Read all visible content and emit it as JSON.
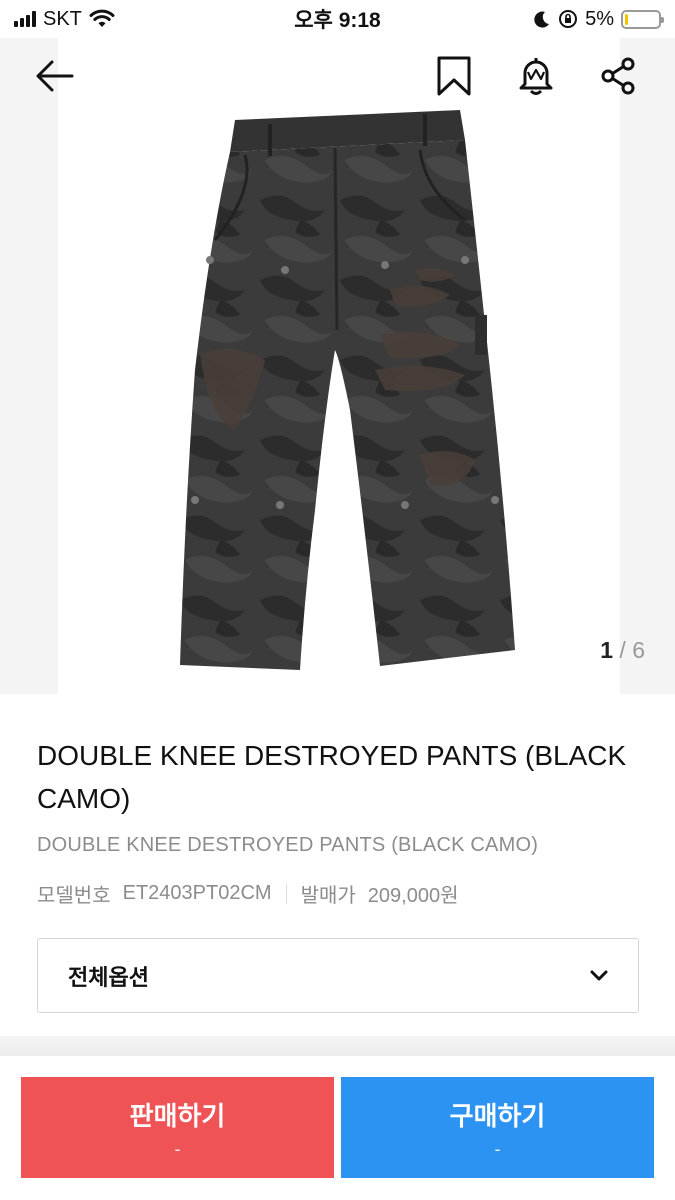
{
  "status_bar": {
    "carrier": "SKT",
    "time": "오후 9:18",
    "battery_percent": "5%",
    "battery_level": 0.05,
    "icons": [
      "signal-bars-icon",
      "wifi-icon",
      "moon-icon",
      "orientation-lock-icon",
      "battery-icon"
    ]
  },
  "nav": {
    "icons": [
      "back-arrow-icon",
      "bookmark-icon",
      "alarm-bell-icon",
      "share-icon"
    ]
  },
  "gallery": {
    "current": "1",
    "separator": " / ",
    "total": "6"
  },
  "product": {
    "title": "DOUBLE KNEE DESTROYED PANTS (BLACK CAMO)",
    "subtitle": "DOUBLE KNEE DESTROYED PANTS (BLACK CAMO)",
    "model_label": "모델번호",
    "model_value": "ET2403PT02CM",
    "price_label": "발매가",
    "price_value": "209,000원"
  },
  "option_select": {
    "label": "전체옵션",
    "icon": "chevron-down-icon"
  },
  "actions": {
    "sell_label": "판매하기",
    "sell_sub": "-",
    "buy_label": "구매하기",
    "buy_sub": "-"
  },
  "colors": {
    "sell": "#ef5356",
    "buy": "#2c93f2",
    "battery": "#f5c400"
  }
}
